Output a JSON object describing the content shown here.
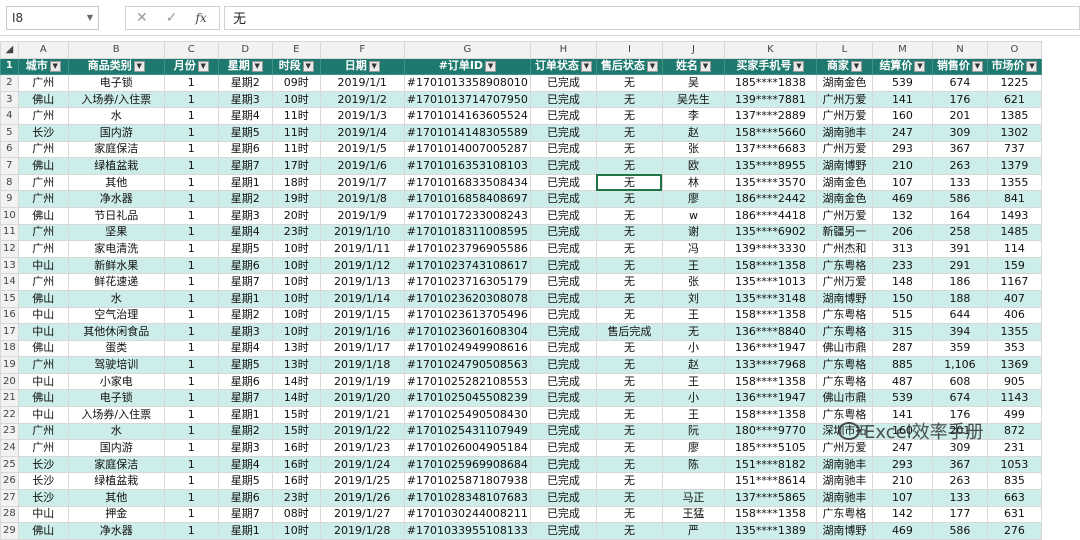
{
  "formula_bar": {
    "name_box": "I8",
    "fx_label": "fx",
    "cancel": "✕",
    "confirm": "✓",
    "formula": "无"
  },
  "columns": [
    "A",
    "B",
    "C",
    "D",
    "E",
    "F",
    "G",
    "H",
    "I",
    "J",
    "K",
    "L",
    "M",
    "N",
    "O"
  ],
  "headers": [
    "城市",
    "商品类别",
    "月份",
    "星期",
    "时段",
    "日期",
    "#订单ID",
    "订单状态",
    "售后状态",
    "姓名",
    "买家手机号",
    "商家",
    "结算价",
    "销售价",
    "市场价"
  ],
  "rows": [
    [
      "广州",
      "电子锁",
      "1",
      "星期2",
      "09时",
      "2019/1/1",
      "#1701013358908010",
      "已完成",
      "无",
      "吴",
      "185****1838",
      "湖南金色",
      "539",
      "674",
      "1225"
    ],
    [
      "佛山",
      "入场券/入住票",
      "1",
      "星期3",
      "10时",
      "2019/1/2",
      "#1701013714707950",
      "已完成",
      "无",
      "吴先生",
      "139****7881",
      "广州万爱",
      "141",
      "176",
      "621"
    ],
    [
      "广州",
      "水",
      "1",
      "星期4",
      "11时",
      "2019/1/3",
      "#1701014163605524",
      "已完成",
      "无",
      "李",
      "137****2889",
      "广州万爱",
      "160",
      "201",
      "1385"
    ],
    [
      "长沙",
      "国内游",
      "1",
      "星期5",
      "11时",
      "2019/1/4",
      "#1701014148305589",
      "已完成",
      "无",
      "赵",
      "158****5660",
      "湖南驰丰",
      "247",
      "309",
      "1302"
    ],
    [
      "广州",
      "家庭保洁",
      "1",
      "星期6",
      "11时",
      "2019/1/5",
      "#1701014007005287",
      "已完成",
      "无",
      "张",
      "137****6683",
      "广州万爱",
      "293",
      "367",
      "737"
    ],
    [
      "佛山",
      "绿植盆栽",
      "1",
      "星期7",
      "17时",
      "2019/1/6",
      "#1701016353108103",
      "已完成",
      "无",
      "欧",
      "135****8955",
      "湖南博野",
      "210",
      "263",
      "1379"
    ],
    [
      "广州",
      "其他",
      "1",
      "星期1",
      "18时",
      "2019/1/7",
      "#1701016833508434",
      "已完成",
      "无",
      "林",
      "135****3570",
      "湖南金色",
      "107",
      "133",
      "1355"
    ],
    [
      "广州",
      "净水器",
      "1",
      "星期2",
      "19时",
      "2019/1/8",
      "#1701016858408697",
      "已完成",
      "无",
      "廖",
      "186****2442",
      "湖南金色",
      "469",
      "586",
      "841"
    ],
    [
      "佛山",
      "节日礼品",
      "1",
      "星期3",
      "20时",
      "2019/1/9",
      "#1701017233008243",
      "已完成",
      "无",
      "w",
      "186****4418",
      "广州万爱",
      "132",
      "164",
      "1493"
    ],
    [
      "广州",
      "坚果",
      "1",
      "星期4",
      "23时",
      "2019/1/10",
      "#1701018311008595",
      "已完成",
      "无",
      "谢",
      "135****6902",
      "新疆另一",
      "206",
      "258",
      "1485"
    ],
    [
      "广州",
      "家电清洗",
      "1",
      "星期5",
      "10时",
      "2019/1/11",
      "#1701023796905586",
      "已完成",
      "无",
      "冯",
      "139****3330",
      "广州杰和",
      "313",
      "391",
      "114"
    ],
    [
      "中山",
      "新鲜水果",
      "1",
      "星期6",
      "10时",
      "2019/1/12",
      "#1701023743108617",
      "已完成",
      "无",
      "王",
      "158****1358",
      "广东粤格",
      "233",
      "291",
      "159"
    ],
    [
      "广州",
      "鲜花速递",
      "1",
      "星期7",
      "10时",
      "2019/1/13",
      "#1701023716305179",
      "已完成",
      "无",
      "张",
      "135****1013",
      "广州万爱",
      "148",
      "186",
      "1167"
    ],
    [
      "佛山",
      "水",
      "1",
      "星期1",
      "10时",
      "2019/1/14",
      "#1701023620308078",
      "已完成",
      "无",
      "刘",
      "135****3148",
      "湖南博野",
      "150",
      "188",
      "407"
    ],
    [
      "中山",
      "空气治理",
      "1",
      "星期2",
      "10时",
      "2019/1/15",
      "#1701023613705496",
      "已完成",
      "无",
      "王",
      "158****1358",
      "广东粤格",
      "515",
      "644",
      "406"
    ],
    [
      "中山",
      "其他休闲食品",
      "1",
      "星期3",
      "10时",
      "2019/1/16",
      "#1701023601608304",
      "已完成",
      "售后完成",
      "无",
      "136****8840",
      "广东粤格",
      "315",
      "394",
      "1355"
    ],
    [
      "佛山",
      "蛋类",
      "1",
      "星期4",
      "13时",
      "2019/1/17",
      "#1701024949908616",
      "已完成",
      "无",
      "小",
      "136****1947",
      "佛山市鼎",
      "287",
      "359",
      "353"
    ],
    [
      "广州",
      "驾驶培训",
      "1",
      "星期5",
      "13时",
      "2019/1/18",
      "#1701024790508563",
      "已完成",
      "无",
      "赵",
      "133****7968",
      "广东粤格",
      "885",
      "1,106",
      "1369"
    ],
    [
      "中山",
      "小家电",
      "1",
      "星期6",
      "14时",
      "2019/1/19",
      "#1701025282108553",
      "已完成",
      "无",
      "王",
      "158****1358",
      "广东粤格",
      "487",
      "608",
      "905"
    ],
    [
      "佛山",
      "电子锁",
      "1",
      "星期7",
      "14时",
      "2019/1/20",
      "#1701025045508239",
      "已完成",
      "无",
      "小",
      "136****1947",
      "佛山市鼎",
      "539",
      "674",
      "1143"
    ],
    [
      "中山",
      "入场券/入住票",
      "1",
      "星期1",
      "15时",
      "2019/1/21",
      "#1701025490508430",
      "已完成",
      "无",
      "王",
      "158****1358",
      "广东粤格",
      "141",
      "176",
      "499"
    ],
    [
      "广州",
      "水",
      "1",
      "星期2",
      "15时",
      "2019/1/22",
      "#1701025431107949",
      "已完成",
      "无",
      "阮",
      "180****9770",
      "深圳市拓",
      "160",
      "201",
      "872"
    ],
    [
      "广州",
      "国内游",
      "1",
      "星期3",
      "16时",
      "2019/1/23",
      "#1701026004905184",
      "已完成",
      "无",
      "廖",
      "185****5105",
      "广州万爱",
      "247",
      "309",
      "231"
    ],
    [
      "长沙",
      "家庭保洁",
      "1",
      "星期4",
      "16时",
      "2019/1/24",
      "#1701025969908684",
      "已完成",
      "无",
      "陈",
      "151****8182",
      "湖南驰丰",
      "293",
      "367",
      "1053"
    ],
    [
      "长沙",
      "绿植盆栽",
      "1",
      "星期5",
      "16时",
      "2019/1/25",
      "#1701025871807938",
      "已完成",
      "无",
      "",
      "151****8614",
      "湖南驰丰",
      "210",
      "263",
      "835"
    ],
    [
      "长沙",
      "其他",
      "1",
      "星期6",
      "23时",
      "2019/1/26",
      "#1701028348107683",
      "已完成",
      "无",
      "马正",
      "137****5865",
      "湖南驰丰",
      "107",
      "133",
      "663"
    ],
    [
      "中山",
      "押金",
      "1",
      "星期7",
      "08时",
      "2019/1/27",
      "#1701030244008211",
      "已完成",
      "无",
      "王猛",
      "158****1358",
      "广东粤格",
      "142",
      "177",
      "631"
    ],
    [
      "佛山",
      "净水器",
      "1",
      "星期1",
      "10时",
      "2019/1/28",
      "#1701033955108133",
      "已完成",
      "无",
      "严",
      "135****1389",
      "湖南博野",
      "469",
      "586",
      "276"
    ]
  ],
  "watermark": "Excel效率手册"
}
